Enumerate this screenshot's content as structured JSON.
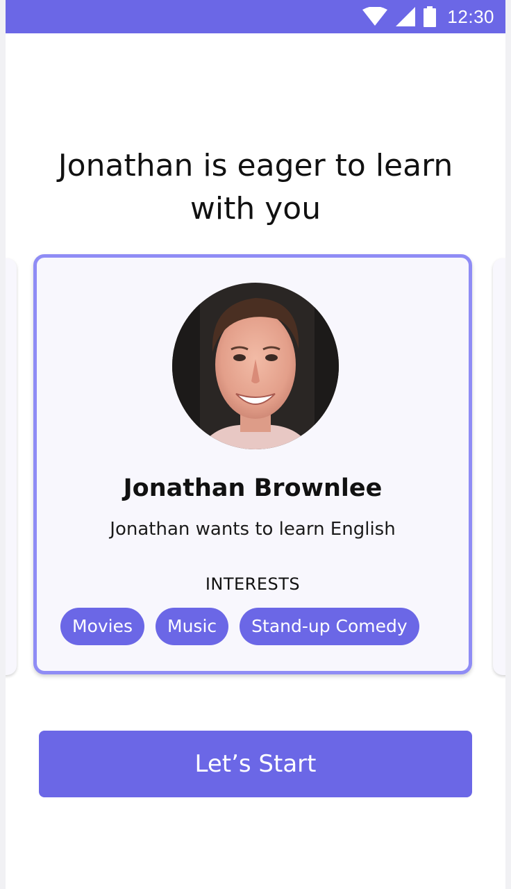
{
  "status_bar": {
    "time": "12:30",
    "icons": [
      "wifi-icon",
      "cellular-signal-icon",
      "battery-icon"
    ],
    "background": "#6b67e6"
  },
  "headline": "Jonathan is eager to learn with you",
  "card": {
    "name": "Jonathan Brownlee",
    "subtitle": "Jonathan wants to learn English",
    "interests_title": "INTERESTS",
    "interests": [
      "Movies",
      "Music",
      "Stand-up Comedy"
    ],
    "border_color": "#8f8cf5"
  },
  "start_button": {
    "label": "Let’s Start",
    "color": "#6b67e6"
  }
}
